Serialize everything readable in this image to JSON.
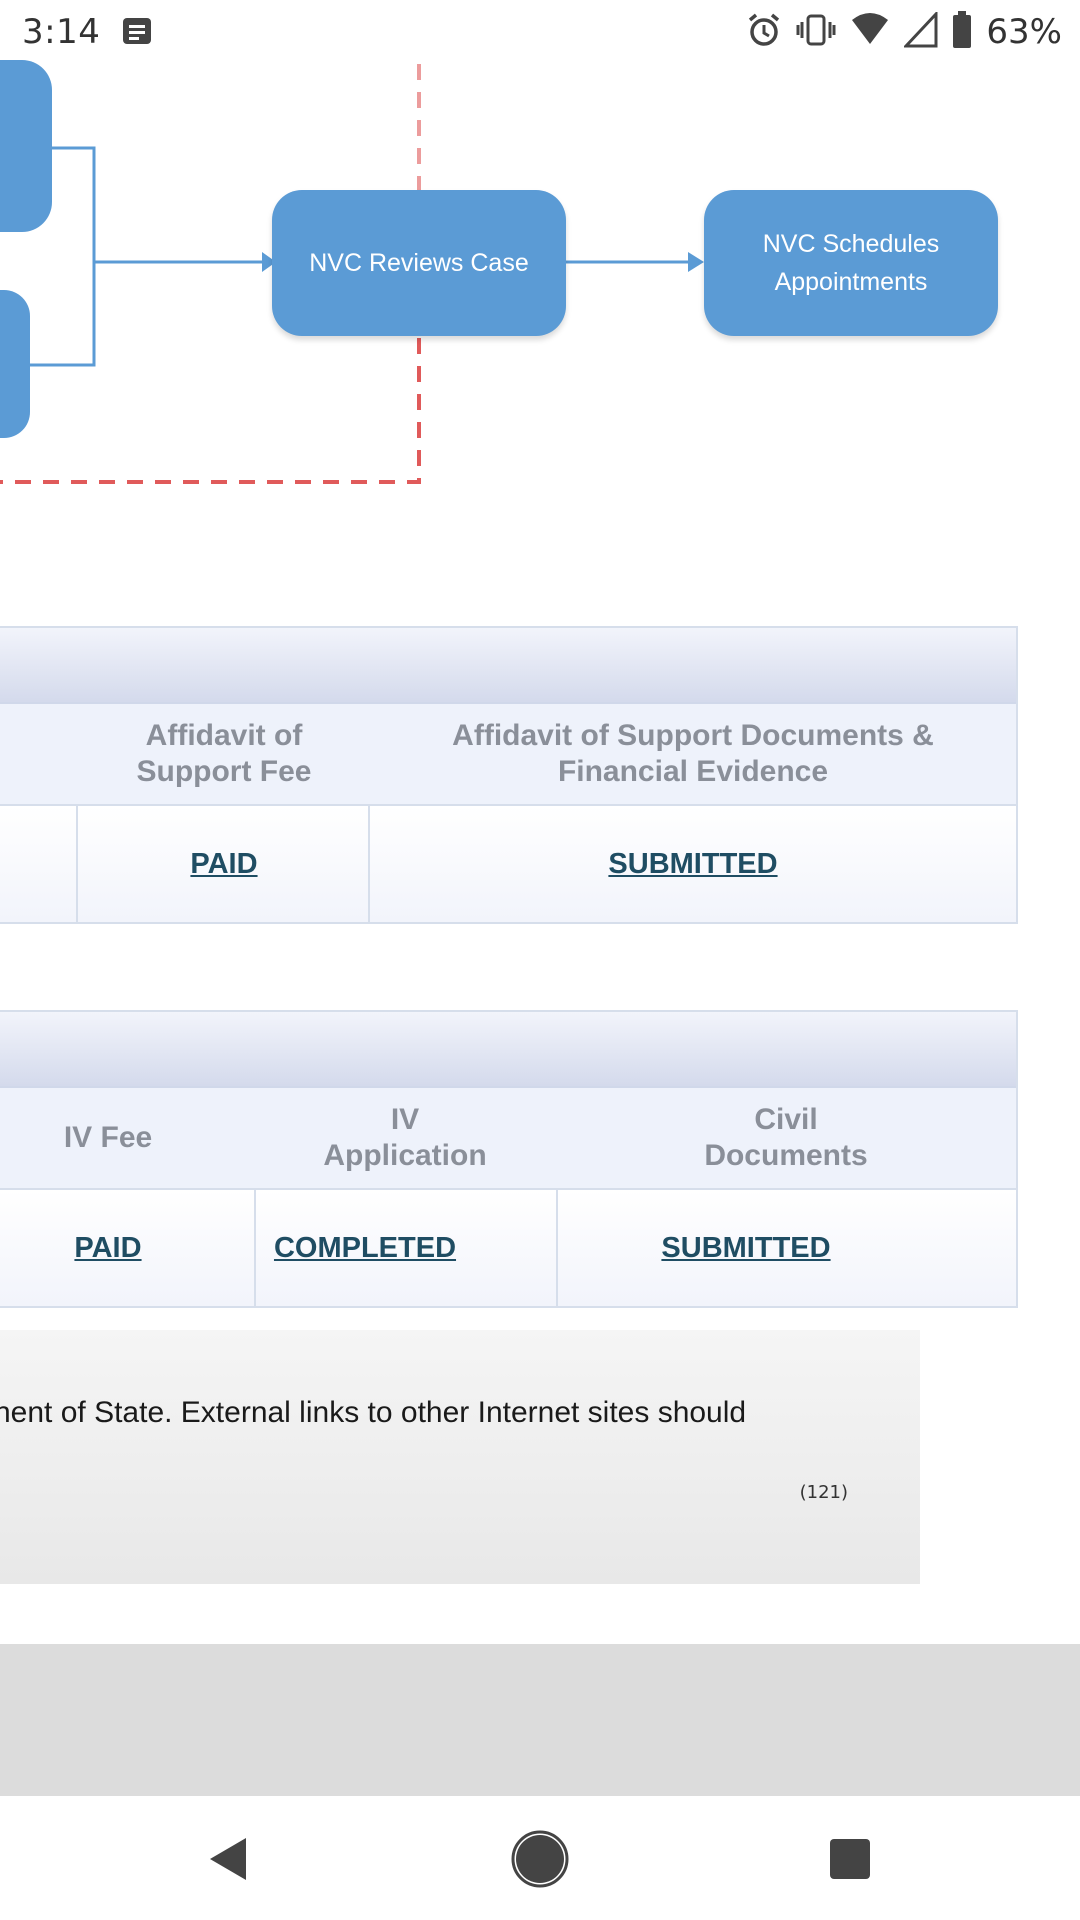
{
  "status_bar": {
    "time": "3:14",
    "battery_percent": "63%",
    "icons": [
      "notification-icon",
      "alarm-icon",
      "vibrate-icon",
      "wifi-icon",
      "signal-icon",
      "battery-icon"
    ]
  },
  "flowchart": {
    "nodes": [
      "NVC Reviews Case",
      "NVC Schedules Appointments"
    ],
    "node_color": "#5b9bd5",
    "connector_color": "#5b9bd5",
    "boundary_color": "#e05a5a"
  },
  "table1": {
    "columns": [
      "Affidavit of Support Fee",
      "Affidavit of Support Documents & Financial Evidence"
    ],
    "values": [
      "PAID",
      "SUBMITTED"
    ]
  },
  "table2": {
    "columns": [
      "IV Fee",
      "IV Application",
      "Civil Documents"
    ],
    "values": [
      "PAID",
      "COMPLETED",
      "SUBMITTED"
    ]
  },
  "notice": {
    "line1": "nent of State. External links to other Internet sites should",
    "line2": ".",
    "count": "(121)"
  },
  "colors": {
    "link": "#1f4d63",
    "header_text": "#8a8f99"
  }
}
